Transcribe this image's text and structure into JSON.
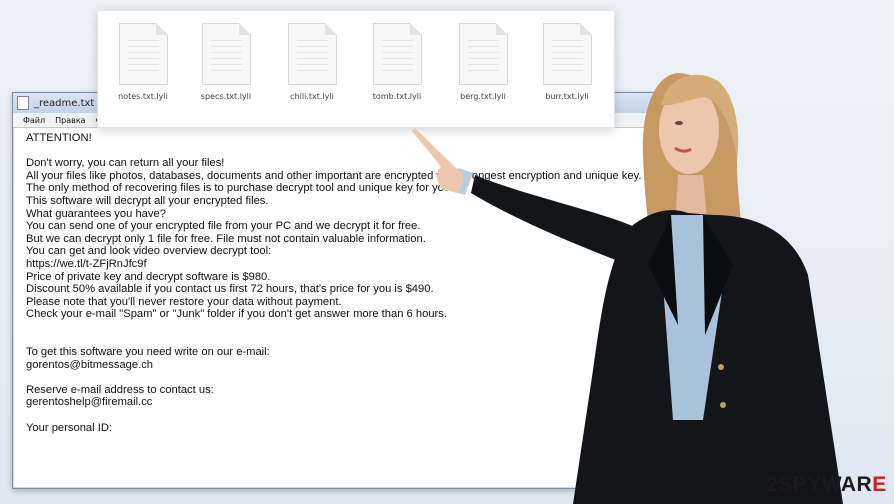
{
  "window": {
    "title": "_readme.txt — Б",
    "menu": [
      "Файл",
      "Правка",
      "Ф"
    ]
  },
  "note_lines": [
    "ATTENTION!",
    "",
    "Don't worry, you can return all your files!",
    "All your files like photos, databases, documents and other important are encrypted with strongest encryption and unique key.",
    "The only method of recovering files is to purchase decrypt tool and unique key for you.",
    "This software will decrypt all your encrypted files.",
    "What guarantees you have?",
    "You can send one of your encrypted file from your PC and we decrypt it for free.",
    "But we can decrypt only 1 file for free. File must not contain valuable information.",
    "You can get and look video overview decrypt tool:",
    "https://we.tl/t-ZFjRnJfc9f",
    "Price of private key and decrypt software is $980.",
    "Discount 50% available if you contact us first 72 hours, that's price for you is $490.",
    "Please note that you'll never restore your data without payment.",
    "Check your e-mail \"Spam\" or \"Junk\" folder if you don't get answer more than 6 hours.",
    "",
    "",
    "To get this software you need write on our e-mail:",
    "gorentos@bitmessage.ch",
    "",
    "Reserve e-mail address to contact us:",
    "gerentoshelp@firemail.cc",
    "",
    "Your personal ID:"
  ],
  "files": [
    {
      "name": "notes.txt.lyli"
    },
    {
      "name": "specs.txt.lyli"
    },
    {
      "name": "chili.txt.lyli"
    },
    {
      "name": "tomb.txt.lyli"
    },
    {
      "name": "berg.txt.lyli"
    },
    {
      "name": "burr.txt.lyli"
    }
  ],
  "watermark": {
    "part1": "2SPYWAR",
    "part2": "E",
    "colors": {
      "dark": "#1b1b1b",
      "accent": "#d41c24"
    }
  }
}
